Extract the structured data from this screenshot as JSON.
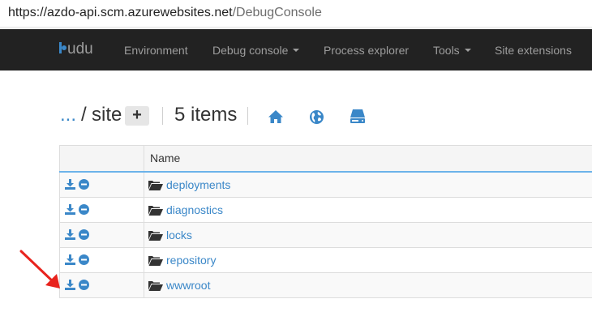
{
  "browser": {
    "url_host": "https://azdo-api.scm.azurewebsites.net",
    "url_path": "/DebugConsole"
  },
  "navbar": {
    "brand": "Kudu",
    "brand_rest": "udu",
    "items": [
      {
        "label": "Environment",
        "dropdown": false
      },
      {
        "label": "Debug console",
        "dropdown": true
      },
      {
        "label": "Process explorer",
        "dropdown": false
      },
      {
        "label": "Tools",
        "dropdown": true
      },
      {
        "label": "Site extensions",
        "dropdown": false
      }
    ]
  },
  "breadcrumb": {
    "ellipsis": "...",
    "separator": "/",
    "current": "site",
    "add_label": "+",
    "item_count": "5 items"
  },
  "toolbar_icons": [
    "home-icon",
    "globe-icon",
    "drive-icon"
  ],
  "table": {
    "header_name": "Name",
    "rows": [
      {
        "name": "deployments"
      },
      {
        "name": "diagnostics"
      },
      {
        "name": "locks"
      },
      {
        "name": "repository"
      },
      {
        "name": "wwwroot"
      }
    ]
  },
  "colors": {
    "navbar_bg": "#222222",
    "link": "#3a87c8",
    "annotation_arrow": "#e8231d"
  }
}
